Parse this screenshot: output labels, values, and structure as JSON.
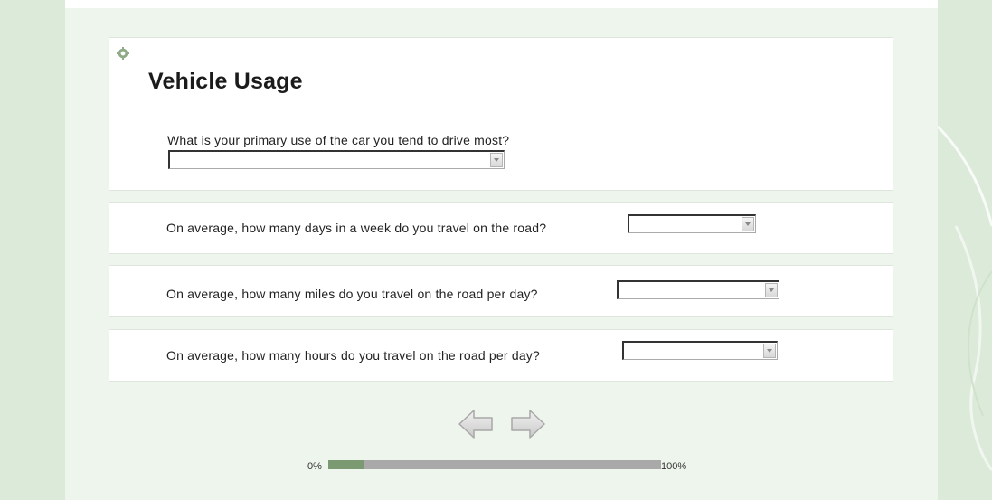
{
  "page": {
    "title": "Vehicle Usage",
    "accent_color": "#7b9a72",
    "background_color": "#eef5ec"
  },
  "questions": [
    {
      "id": "primary_use",
      "text": "What is your primary use of the car you tend to drive most?",
      "value": ""
    },
    {
      "id": "days_per_week",
      "text": "On average, how many days in a week do you travel on the road?",
      "value": ""
    },
    {
      "id": "miles_per_day",
      "text": "On average, how many miles do you travel on the road per day?",
      "value": ""
    },
    {
      "id": "hours_per_day",
      "text": "On average, how many hours do you travel on the road per day?",
      "value": ""
    }
  ],
  "navigation": {
    "back_icon": "arrow-left-icon",
    "next_icon": "arrow-right-icon"
  },
  "progress": {
    "start_label": "0%",
    "end_label": "100%",
    "fraction": 0.11
  }
}
